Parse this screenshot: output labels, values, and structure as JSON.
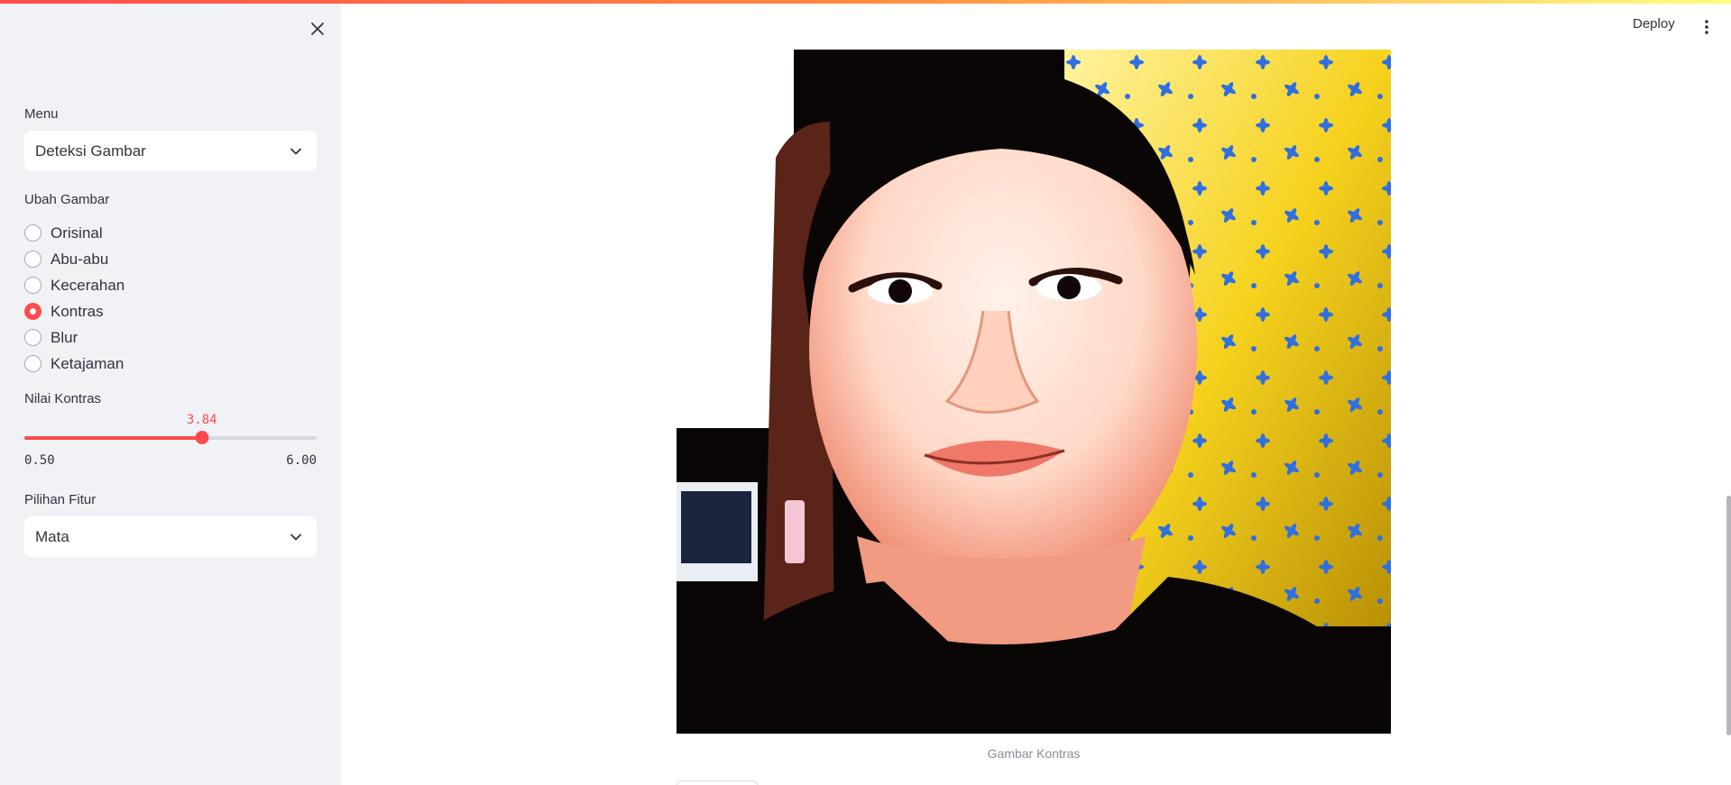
{
  "app": {
    "accent_color": "#ff4b4b"
  },
  "header": {
    "deploy_label": "Deploy",
    "menu_icon": "more-vertical-icon"
  },
  "sidebar": {
    "close_icon": "close-icon",
    "menu": {
      "label": "Menu",
      "value": "Deteksi Gambar"
    },
    "ubah_gambar": {
      "label": "Ubah Gambar",
      "options": [
        "Orisinal",
        "Abu-abu",
        "Kecerahan",
        "Kontras",
        "Blur",
        "Ketajaman"
      ],
      "selected": "Kontras"
    },
    "slider": {
      "label": "Nilai Kontras",
      "value": "3.84",
      "min": "0.50",
      "max": "6.00"
    },
    "pilihan_fitur": {
      "label": "Pilihan Fitur",
      "value": "Mata"
    }
  },
  "main": {
    "image": {
      "caption": "Gambar Kontras"
    }
  }
}
